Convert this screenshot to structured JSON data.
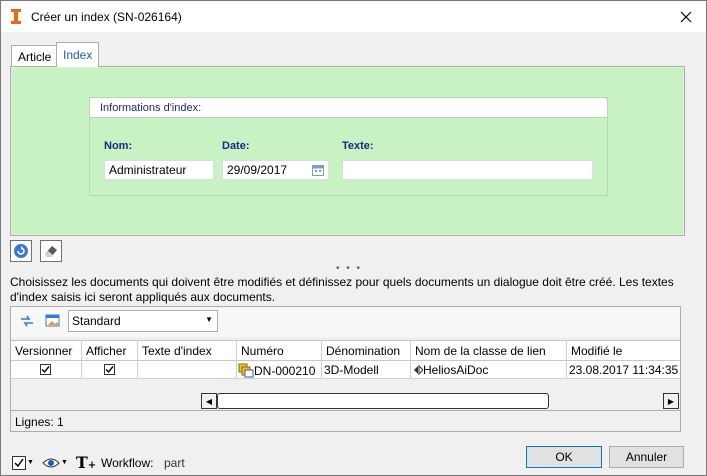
{
  "window": {
    "title": "Créer un index (SN-026164)"
  },
  "tabs": [
    {
      "label": "Article",
      "active": false
    },
    {
      "label": "Index",
      "active": true
    }
  ],
  "index_group": {
    "header": "Informations d'index:",
    "fields": {
      "nom": {
        "label": "Nom:",
        "value": "Administrateur"
      },
      "date": {
        "label": "Date:",
        "value": "29/09/2017"
      },
      "texte": {
        "label": "Texte:",
        "value": ""
      }
    }
  },
  "instructions": "Choisissez les documents qui doivent être modifiés et définissez pour quels documents un dialogue doit être créé.  Les textes d'index saisis ici seront appliqués aux documents.",
  "grid": {
    "view_select": "Standard",
    "columns": [
      "Versionner",
      "Afficher",
      "Texte d'index",
      "Numéro",
      "Dénomination",
      "Nom de la classe de lien",
      "Modifié le"
    ],
    "rows": [
      {
        "versionner": true,
        "afficher": true,
        "texte_index": "",
        "numero": "DN-000210",
        "denomination": "3D-Modell",
        "classe_lien": "HeliosAiDoc",
        "modifie_le": "23.08.2017 11:34:35"
      }
    ],
    "rows_count": "Lignes: 1"
  },
  "footer": {
    "workflow_label": "Workflow:",
    "workflow_value": "part",
    "ok_label": "OK",
    "cancel_label": "Annuler"
  },
  "colors": {
    "tab_panel_bg": "#c8f2c4",
    "accent_blue": "#1a2a7a",
    "title_orange": "#e86a10"
  },
  "icons": [
    "app-logo-icon",
    "close-icon",
    "refresh-icon",
    "eraser-icon",
    "sync-icon",
    "image-settings-icon",
    "calendar-icon",
    "document-stack-icon",
    "link-class-icon",
    "checkmark-dropdown-icon",
    "eye-dropdown-icon",
    "text-format-icon"
  ]
}
